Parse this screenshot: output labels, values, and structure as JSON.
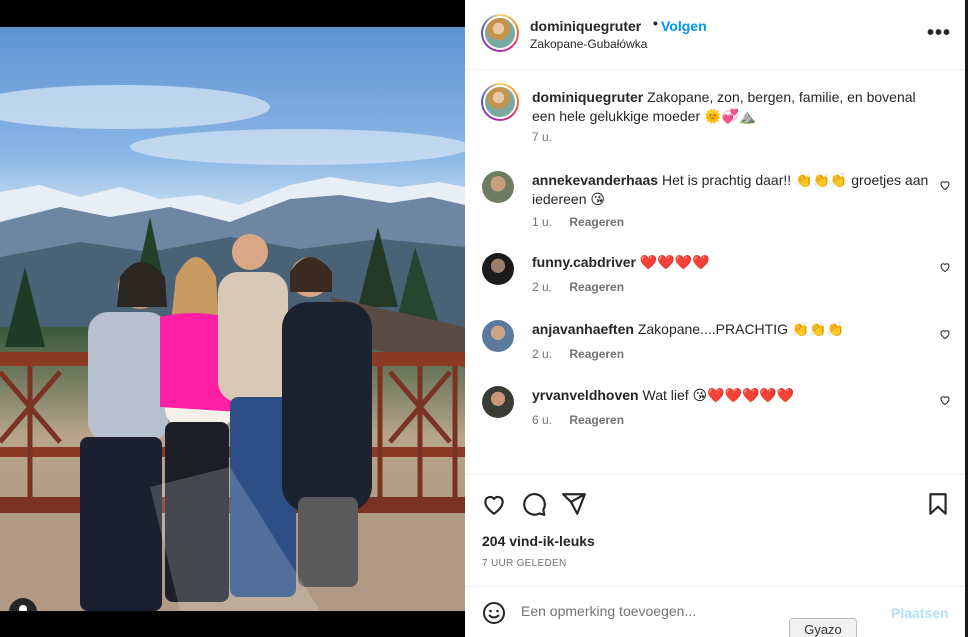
{
  "post": {
    "username": "dominiquegruter",
    "separator": "•",
    "follow_label": "Volgen",
    "location": "Zakopane-Gubałówka",
    "more_label": "•••",
    "caption_text": "Zakopane, zon, bergen, familie, en bovenal een hele gelukkige moeder 🌞💞⛰️",
    "caption_time": "7 u."
  },
  "comments": [
    {
      "username": "annekevanderhaas",
      "text": "Het is prachtig daar!! 👏👏👏 groetjes aan iedereen 😘",
      "time": "1 u.",
      "reply": "Reageren"
    },
    {
      "username": "funny.cabdriver",
      "text": "❤️❤️❤️❤️",
      "time": "2 u.",
      "reply": "Reageren"
    },
    {
      "username": "anjavanhaeften",
      "text": "Zakopane....PRACHTIG 👏👏👏",
      "time": "2 u.",
      "reply": "Reageren"
    },
    {
      "username": "yrvanveldhoven",
      "text": "Wat lief 😘❤️❤️❤️❤️❤️",
      "time": "6 u.",
      "reply": "Reageren"
    }
  ],
  "actions": {
    "likes": "204 vind-ik-leuks",
    "posted_ago": "7 UUR GELEDEN"
  },
  "comment_box": {
    "placeholder": "Een opmerking toevoegen...",
    "post_label": "Plaatsen"
  },
  "overlay": {
    "gyazo_label": "Gyazo"
  },
  "colors": {
    "accent": "#0095f6",
    "post_disabled": "#b2dffc",
    "muted_text": "#737373"
  }
}
